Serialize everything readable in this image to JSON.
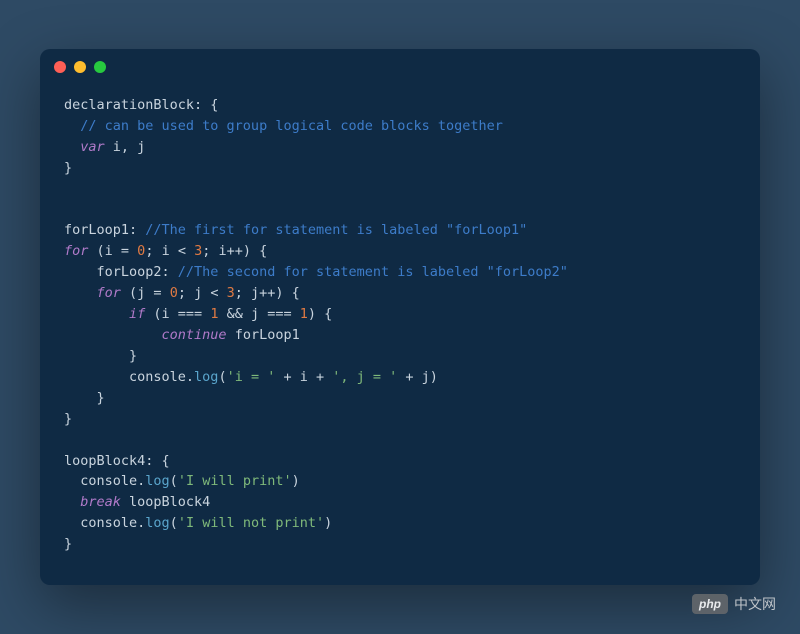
{
  "code": {
    "l1": {
      "a": "declarationBlock: {"
    },
    "l2": {
      "a": "  // can be used to group logical code blocks together"
    },
    "l3": {
      "a": "  var",
      "b": " i, j"
    },
    "l4": {
      "a": "}"
    },
    "l5": {
      "a": "forLoop1:",
      "b": " //The first for statement is labeled \"forLoop1\""
    },
    "l6": {
      "a": "for",
      "b": " (i = ",
      "c": "0",
      "d": "; i < ",
      "e": "3",
      "f": "; i++) {"
    },
    "l7": {
      "a": "    forLoop2:",
      "b": " //The second for statement is labeled \"forLoop2\""
    },
    "l8": {
      "a": "    for",
      "b": " (j = ",
      "c": "0",
      "d": "; j < ",
      "e": "3",
      "f": "; j++) {"
    },
    "l9": {
      "a": "        if",
      "b": " (i === ",
      "c": "1",
      "d": " && j === ",
      "e": "1",
      "f": ") {"
    },
    "l10": {
      "a": "            continue",
      "b": " forLoop1"
    },
    "l11": {
      "a": "        }"
    },
    "l12": {
      "a": "        console.",
      "b": "log",
      "c": "(",
      "d": "'i = '",
      "e": " + i + ",
      "f": "', j = '",
      "g": " + j)"
    },
    "l13": {
      "a": "    }"
    },
    "l14": {
      "a": "}"
    },
    "l15": {
      "a": "loopBlock4: {"
    },
    "l16": {
      "a": "  console.",
      "b": "log",
      "c": "(",
      "d": "'I will print'",
      "e": ")"
    },
    "l17": {
      "a": "  break",
      "b": " loopBlock4"
    },
    "l18": {
      "a": "  console.",
      "b": "log",
      "c": "(",
      "d": "'I will not print'",
      "e": ")"
    },
    "l19": {
      "a": "}"
    }
  },
  "watermark": {
    "badge": "php",
    "text": "中文网"
  }
}
